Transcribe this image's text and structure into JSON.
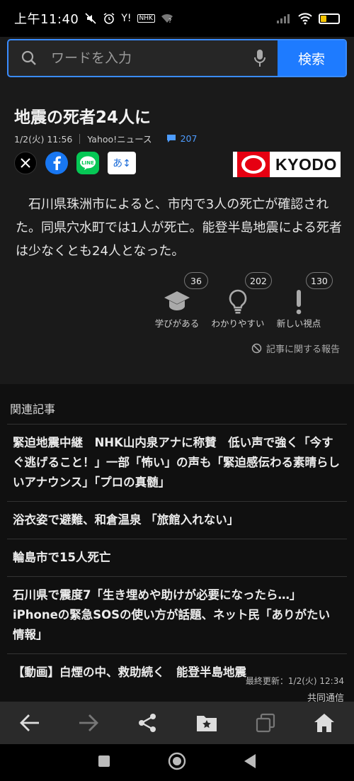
{
  "status_bar": {
    "time": "上午11:40",
    "icons": [
      "mute-icon",
      "alarm-icon",
      "yahoo-icon",
      "nhk-icon",
      "wifi-off-icon"
    ],
    "yahoo_label": "Y!",
    "nhk_label": "NHK",
    "battery": "48",
    "battery_level": 0.48
  },
  "search": {
    "placeholder": "ワードを入力",
    "button_label": "検索"
  },
  "article": {
    "title": "地震の死者24人に",
    "date": "1/2(火) 11:56",
    "source": "Yahoo!ニュース",
    "comment_count": "207",
    "translate_label": "あ↕",
    "publisher_logo_text": "KYODO",
    "body": "石川県珠洲市によると、市内で3人の死亡が確認された。同県穴水町では1人が死亡。能登半島地震による死者は少なくとも24人となった。",
    "reactions": [
      {
        "label": "学びがある",
        "count": "36",
        "icon": "graduation-cap-icon"
      },
      {
        "label": "わかりやすい",
        "count": "202",
        "icon": "lightbulb-icon"
      },
      {
        "label": "新しい視点",
        "count": "130",
        "icon": "exclamation-icon"
      }
    ],
    "report_label": "記事に関する報告"
  },
  "related": {
    "title": "関連記事",
    "items": [
      "緊迫地震中継　NHK山内泉アナに称賛　低い声で強く「今すぐ逃げること！」一部「怖い」の声も「緊迫感伝わる素晴らしいアナウンス」「プロの真髄」",
      "浴衣姿で避難、和倉温泉 「旅館入れない」",
      "輪島市で15人死亡",
      "石川県で震度7「生き埋めや助けが必要になったら…」iPhoneの緊急SOSの使い方が話題、ネット民「ありがたい情報」",
      "【動画】白煙の中、救助続く　能登半島地震"
    ],
    "updated": "最終更新：1/2(火) 12:34",
    "source": "共同通信"
  },
  "toolbar": [
    "back-icon",
    "forward-icon",
    "share-icon",
    "bookmark-folder-icon",
    "tabs-icon",
    "home-icon"
  ],
  "colors": {
    "accent": "#1e7bff",
    "comment": "#4d9cff",
    "background": "#101010",
    "card": "#1a1a1a"
  }
}
